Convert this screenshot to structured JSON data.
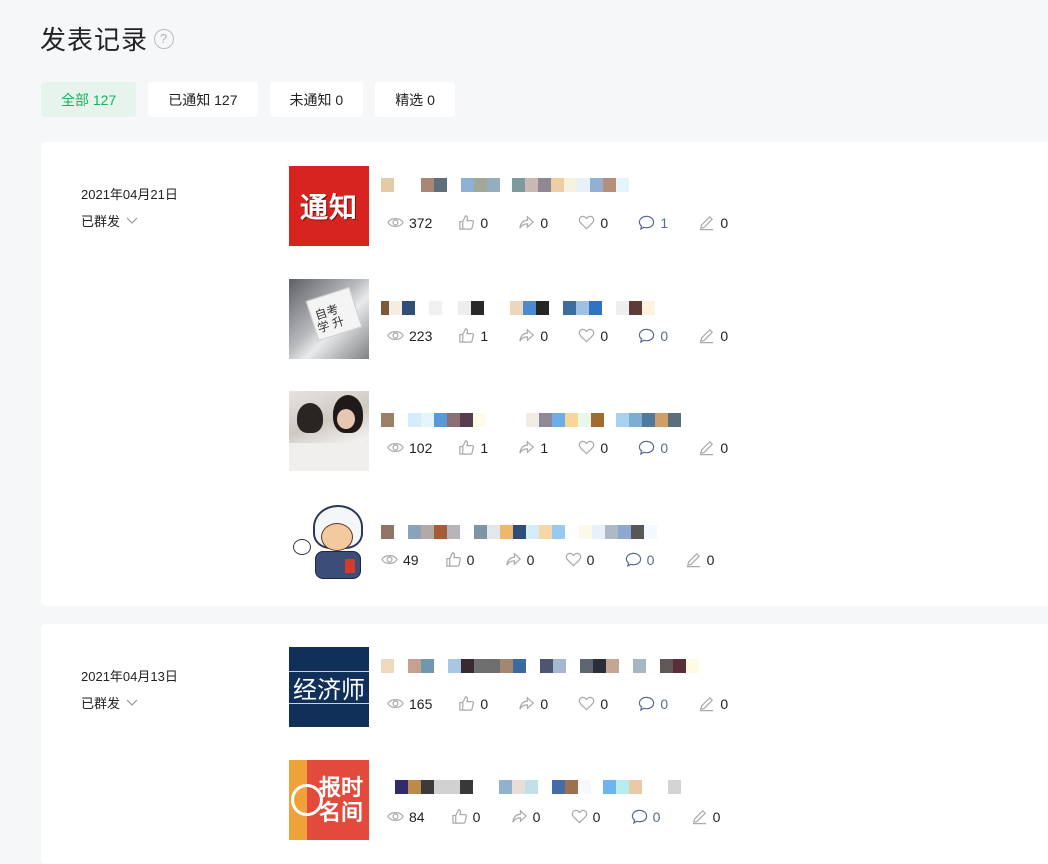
{
  "header": {
    "title": "发表记录",
    "help_icon": "?"
  },
  "tabs": [
    {
      "label": "全部 127",
      "active": true
    },
    {
      "label": "已通知 127",
      "active": false
    },
    {
      "label": "未通知 0",
      "active": false
    },
    {
      "label": "精选 0",
      "active": false
    }
  ],
  "groups": [
    {
      "date": "2021年04月21日",
      "status": "已群发",
      "items": [
        {
          "thumb_text": "通知",
          "stats": {
            "views": "372",
            "likes": "0",
            "shares": "0",
            "favs": "0",
            "comments": "1",
            "edits": "0"
          }
        },
        {
          "thumb_text": "自考学 升",
          "stats": {
            "views": "223",
            "likes": "1",
            "shares": "0",
            "favs": "0",
            "comments": "0",
            "edits": "0"
          }
        },
        {
          "thumb_text": "",
          "stats": {
            "views": "102",
            "likes": "1",
            "shares": "1",
            "favs": "0",
            "comments": "0",
            "edits": "0"
          }
        },
        {
          "thumb_text": "",
          "stats": {
            "views": "49",
            "likes": "0",
            "shares": "0",
            "favs": "0",
            "comments": "0",
            "edits": "0"
          }
        }
      ]
    },
    {
      "date": "2021年04月13日",
      "status": "已群发",
      "items": [
        {
          "thumb_text": "经济师",
          "stats": {
            "views": "165",
            "likes": "0",
            "shares": "0",
            "favs": "0",
            "comments": "0",
            "edits": "0"
          }
        },
        {
          "thumb_text": "报时 名间",
          "stats": {
            "views": "84",
            "likes": "0",
            "shares": "0",
            "favs": "0",
            "comments": "0",
            "edits": "0"
          }
        }
      ]
    }
  ],
  "colors": {
    "accent_green": "#14b35a",
    "active_tab_bg": "#e6f4ed",
    "comment_link": "#576b95"
  }
}
